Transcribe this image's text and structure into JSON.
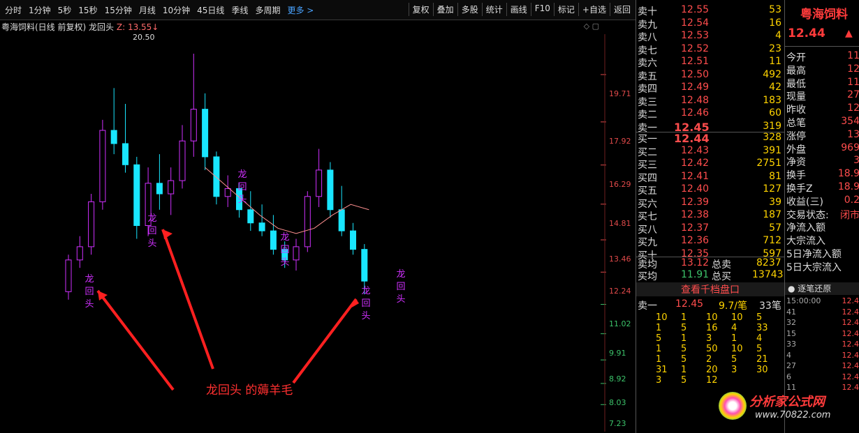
{
  "toolbar": {
    "periods": [
      "分时",
      "1分钟",
      "5秒",
      "15秒",
      "15分钟",
      "月线",
      "10分钟",
      "45日线",
      "季线",
      "多周期",
      "更多 >"
    ],
    "tools": [
      "复权",
      "叠加",
      "多股",
      "统计",
      "画线",
      "F10",
      "标记",
      "+自选",
      "返回"
    ]
  },
  "chart": {
    "title_stock": "粤海饲料(日线 前复权)",
    "indicator_name": "龙回头",
    "indicator_z": "Z: 13.55↓",
    "high_label": "20.50",
    "annotation": "龙回头 的薅羊毛",
    "signal_text": "龙回头",
    "y_ticks": [
      "19.71",
      "17.92",
      "16.29",
      "14.81",
      "13.46",
      "12.24",
      "11.02",
      "9.91",
      "8.92",
      "8.03",
      "7.23"
    ],
    "candles": [
      [
        11.5,
        12.9,
        11.2,
        12.7
      ],
      [
        12.7,
        13.6,
        12.4,
        13.2
      ],
      [
        13.2,
        15.2,
        12.9,
        14.9
      ],
      [
        14.9,
        18.0,
        14.6,
        17.6
      ],
      [
        17.6,
        19.2,
        16.7,
        17.1
      ],
      [
        17.1,
        18.6,
        16.0,
        16.3
      ],
      [
        16.3,
        16.6,
        13.5,
        14.0
      ],
      [
        14.0,
        16.2,
        13.6,
        15.6
      ],
      [
        15.6,
        16.7,
        14.6,
        15.2
      ],
      [
        15.2,
        16.2,
        14.4,
        15.7
      ],
      [
        15.7,
        17.8,
        15.4,
        17.2
      ],
      [
        17.2,
        20.5,
        16.6,
        18.4
      ],
      [
        18.4,
        19.0,
        16.1,
        16.6
      ],
      [
        16.6,
        16.8,
        14.8,
        15.1
      ],
      [
        15.1,
        15.9,
        14.7,
        15.4
      ],
      [
        15.4,
        15.6,
        14.3,
        14.6
      ],
      [
        14.6,
        15.3,
        13.8,
        14.1
      ],
      [
        14.1,
        14.8,
        13.6,
        13.8
      ],
      [
        13.8,
        14.4,
        12.9,
        13.1
      ],
      [
        13.1,
        13.4,
        12.4,
        12.7
      ],
      [
        12.7,
        13.5,
        12.3,
        13.2
      ],
      [
        13.2,
        15.3,
        13.0,
        15.1
      ],
      [
        15.1,
        16.9,
        14.7,
        16.1
      ],
      [
        16.1,
        16.4,
        14.3,
        14.6
      ],
      [
        14.6,
        15.5,
        13.6,
        13.8
      ],
      [
        13.8,
        14.1,
        12.9,
        13.1
      ],
      [
        13.1,
        13.3,
        11.4,
        11.9
      ]
    ],
    "ma_line": [
      16.2,
      15.6,
      15.0,
      14.4,
      13.9,
      13.7,
      13.9,
      14.4,
      14.8,
      14.6
    ]
  },
  "book": {
    "sell": [
      {
        "label": "卖十",
        "price": "12.55",
        "vol": "53"
      },
      {
        "label": "卖九",
        "price": "12.54",
        "vol": "16"
      },
      {
        "label": "卖八",
        "price": "12.53",
        "vol": "4"
      },
      {
        "label": "卖七",
        "price": "12.52",
        "vol": "23"
      },
      {
        "label": "卖六",
        "price": "12.51",
        "vol": "11"
      },
      {
        "label": "卖五",
        "price": "12.50",
        "vol": "492"
      },
      {
        "label": "卖四",
        "price": "12.49",
        "vol": "42"
      },
      {
        "label": "卖三",
        "price": "12.48",
        "vol": "183"
      },
      {
        "label": "卖二",
        "price": "12.46",
        "vol": "60"
      },
      {
        "label": "卖一",
        "price": "12.45",
        "vol": "319"
      }
    ],
    "buy": [
      {
        "label": "买一",
        "price": "12.44",
        "vol": "328"
      },
      {
        "label": "买二",
        "price": "12.43",
        "vol": "391"
      },
      {
        "label": "买三",
        "price": "12.42",
        "vol": "2751"
      },
      {
        "label": "买四",
        "price": "12.41",
        "vol": "81"
      },
      {
        "label": "买五",
        "price": "12.40",
        "vol": "127"
      },
      {
        "label": "买六",
        "price": "12.39",
        "vol": "39"
      },
      {
        "label": "买七",
        "price": "12.38",
        "vol": "187"
      },
      {
        "label": "买八",
        "price": "12.37",
        "vol": "57"
      },
      {
        "label": "买九",
        "price": "12.36",
        "vol": "712"
      },
      {
        "label": "买十",
        "price": "12.35",
        "vol": "597"
      }
    ],
    "sell_avg_label": "卖均",
    "sell_avg": "13.12",
    "total_sell_label": "总卖",
    "total_sell": "8237",
    "buy_avg_label": "买均",
    "buy_avg": "11.91",
    "total_buy_label": "总买",
    "total_buy": "13743",
    "view_1000": "查看千档盘口",
    "queue_head_label": "卖一",
    "queue_head_price": "12.45",
    "queue_head_avg": "9.7/笔",
    "queue_head_count": "33笔",
    "queue": [
      [
        "10",
        "1",
        "10",
        "10",
        "5"
      ],
      [
        "1",
        "5",
        "16",
        "4",
        "33"
      ],
      [
        "5",
        "1",
        "3",
        "1",
        "4"
      ],
      [
        "1",
        "5",
        "50",
        "10",
        "5"
      ],
      [
        "1",
        "5",
        "2",
        "5",
        "21"
      ],
      [
        "31",
        "1",
        "20",
        "3",
        "30"
      ],
      [
        "3",
        "5",
        "12",
        "",
        ""
      ]
    ]
  },
  "info": {
    "name": "粤海饲料",
    "last": "12.44",
    "rows": [
      {
        "k": "今开",
        "v": "11"
      },
      {
        "k": "最高",
        "v": "12"
      },
      {
        "k": "最低",
        "v": "11"
      },
      {
        "k": "现量",
        "v": "27"
      },
      {
        "k": "昨收",
        "v": "12"
      },
      {
        "k": "总笔",
        "v": "354"
      },
      {
        "k": "涨停",
        "v": "13"
      },
      {
        "k": "外盘",
        "v": "969"
      },
      {
        "k": "净资",
        "v": "3"
      },
      {
        "k": "换手",
        "v": "18.9"
      },
      {
        "k": "换手Z",
        "v": "18.9"
      },
      {
        "k": "收益(三)",
        "v": "0.2"
      },
      {
        "k": "交易状态:",
        "v": "闭市"
      },
      {
        "k": "净流入额",
        "v": ""
      },
      {
        "k": "大宗流入",
        "v": ""
      },
      {
        "k": "5日净流入额",
        "v": ""
      },
      {
        "k": "5日大宗流入",
        "v": ""
      }
    ],
    "tick_title": "逐笔还原",
    "ticks": [
      {
        "t": "15:00:00",
        "v": "12.4"
      },
      {
        "t": "41",
        "v": "12.4"
      },
      {
        "t": "32",
        "v": "12.4"
      },
      {
        "t": "15",
        "v": "12.4"
      },
      {
        "t": "33",
        "v": "12.4"
      },
      {
        "t": "4",
        "v": "12.4"
      },
      {
        "t": "27",
        "v": "12.4"
      },
      {
        "t": "6",
        "v": "12.4"
      },
      {
        "t": "11",
        "v": "12.4"
      }
    ],
    "logo_text": "分析家公式网",
    "logo_url": "www.70822.com"
  }
}
